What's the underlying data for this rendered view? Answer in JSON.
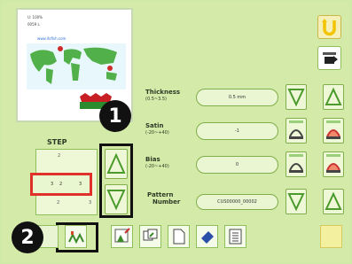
{
  "preview": {
    "line1": "U: 100%",
    "line2": "0059 L",
    "line3": "www.itsfish.com"
  },
  "properties": {
    "thickness": {
      "title": "Thickness",
      "range": "(0.5~3.5)",
      "value": "0.5 mm"
    },
    "satin": {
      "title": "Satin",
      "range": "(-20~+40)",
      "value": "-1"
    },
    "bias": {
      "title": "Bias",
      "range": "(-20~+40)",
      "value": "0"
    },
    "pattern": {
      "title": "Pattern",
      "title2": "Number",
      "value": "CUS00000_00002"
    }
  },
  "step": {
    "label": "STEP",
    "rows": [
      {
        "left": "2",
        "center": "",
        "right": ""
      },
      {
        "left": "3",
        "center": "2",
        "right": "3"
      },
      {
        "left": "2",
        "center": "",
        "right": "3"
      }
    ]
  },
  "markers": {
    "one": "1",
    "two": "2"
  },
  "colors": {
    "accent_green": "#4a9a2c",
    "highlight_red": "#e0302a",
    "marker_black": "#111111",
    "yellow_button": "#f3e01a"
  }
}
